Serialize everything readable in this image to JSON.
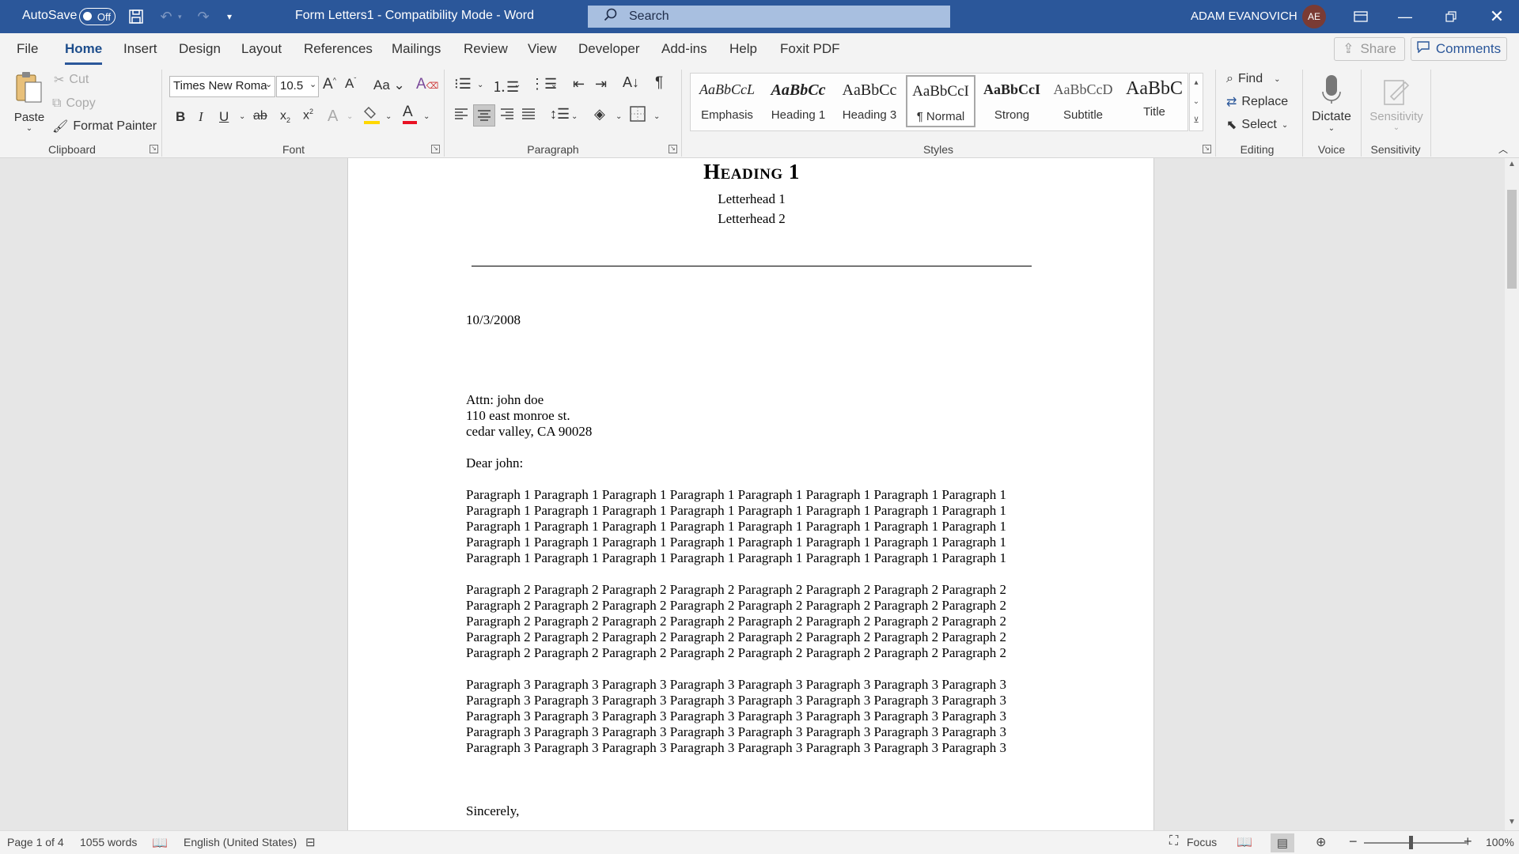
{
  "titlebar": {
    "autosave_label": "AutoSave",
    "autosave_state": "Off",
    "doc_title": "Form Letters1  -  Compatibility Mode  -  Word",
    "search_placeholder": "Search",
    "user_name": "ADAM EVANOVICH",
    "user_initials": "AE"
  },
  "tabs": [
    "File",
    "Home",
    "Insert",
    "Design",
    "Layout",
    "References",
    "Mailings",
    "Review",
    "View",
    "Developer",
    "Add-ins",
    "Help",
    "Foxit PDF"
  ],
  "active_tab": "Home",
  "share_label": "Share",
  "comments_label": "Comments",
  "clipboard": {
    "paste": "Paste",
    "cut": "Cut",
    "copy": "Copy",
    "format_painter": "Format Painter",
    "group": "Clipboard"
  },
  "font": {
    "name": "Times New Roma",
    "size": "10.5",
    "group": "Font"
  },
  "paragraph": {
    "group": "Paragraph"
  },
  "styles": {
    "items": [
      {
        "preview": "AaBbCcL",
        "name": "Emphasis"
      },
      {
        "preview": "AaBbCc",
        "name": "Heading 1"
      },
      {
        "preview": "AaBbCc",
        "name": "Heading 3"
      },
      {
        "preview": "AaBbCcI",
        "name": "¶ Normal"
      },
      {
        "preview": "AaBbCcI",
        "name": "Strong"
      },
      {
        "preview": "AaBbCcD",
        "name": "Subtitle"
      },
      {
        "preview": "AaBbC",
        "name": "Title"
      }
    ],
    "group": "Styles"
  },
  "editing": {
    "find": "Find",
    "replace": "Replace",
    "select": "Select",
    "group": "Editing"
  },
  "voice": {
    "dictate": "Dictate",
    "group": "Voice"
  },
  "sensitivity": {
    "label": "Sensitivity",
    "group": "Sensitivity"
  },
  "document": {
    "heading": "Heading 1",
    "letterhead1": "Letterhead 1",
    "letterhead2": "Letterhead 2",
    "date": "10/3/2008",
    "address": [
      "Attn: john doe",
      "110 east monroe st.",
      "cedar valley, CA 90028"
    ],
    "salutation": "Dear john:",
    "paragraphs": [
      [
        "Paragraph 1 Paragraph 1 Paragraph 1 Paragraph 1 Paragraph 1 Paragraph 1 Paragraph 1 Paragraph 1",
        "Paragraph 1 Paragraph 1 Paragraph 1 Paragraph 1 Paragraph 1 Paragraph 1 Paragraph 1 Paragraph 1",
        "Paragraph 1 Paragraph 1 Paragraph 1 Paragraph 1 Paragraph 1 Paragraph 1 Paragraph 1 Paragraph 1",
        "Paragraph 1 Paragraph 1 Paragraph 1 Paragraph 1 Paragraph 1 Paragraph 1 Paragraph 1 Paragraph 1",
        "Paragraph 1 Paragraph 1 Paragraph 1 Paragraph 1 Paragraph 1 Paragraph 1 Paragraph 1 Paragraph 1"
      ],
      [
        "Paragraph 2 Paragraph 2 Paragraph 2 Paragraph 2 Paragraph 2 Paragraph 2 Paragraph 2 Paragraph 2",
        "Paragraph 2 Paragraph 2 Paragraph 2 Paragraph 2 Paragraph 2 Paragraph 2 Paragraph 2 Paragraph 2",
        "Paragraph 2 Paragraph 2 Paragraph 2 Paragraph 2 Paragraph 2 Paragraph 2 Paragraph 2 Paragraph 2",
        "Paragraph 2 Paragraph 2 Paragraph 2 Paragraph 2 Paragraph 2 Paragraph 2 Paragraph 2 Paragraph 2",
        "Paragraph 2 Paragraph 2 Paragraph 2 Paragraph 2 Paragraph 2 Paragraph 2 Paragraph 2 Paragraph 2"
      ],
      [
        "Paragraph 3 Paragraph 3 Paragraph 3 Paragraph 3 Paragraph 3 Paragraph 3 Paragraph 3 Paragraph 3",
        "Paragraph 3 Paragraph 3 Paragraph 3 Paragraph 3 Paragraph 3 Paragraph 3 Paragraph 3 Paragraph 3",
        "Paragraph 3 Paragraph 3 Paragraph 3 Paragraph 3 Paragraph 3 Paragraph 3 Paragraph 3 Paragraph 3",
        "Paragraph 3 Paragraph 3 Paragraph 3 Paragraph 3 Paragraph 3 Paragraph 3 Paragraph 3 Paragraph 3",
        "Paragraph 3 Paragraph 3 Paragraph 3 Paragraph 3 Paragraph 3 Paragraph 3 Paragraph 3 Paragraph 3"
      ]
    ],
    "closing": "Sincerely,"
  },
  "status": {
    "page": "Page 1 of 4",
    "words": "1055 words",
    "language": "English (United States)",
    "focus": "Focus",
    "zoom": "100%"
  },
  "colors": {
    "titlebar": "#2b579a",
    "font_color": "#e81123",
    "highlight": "#ffd800"
  }
}
